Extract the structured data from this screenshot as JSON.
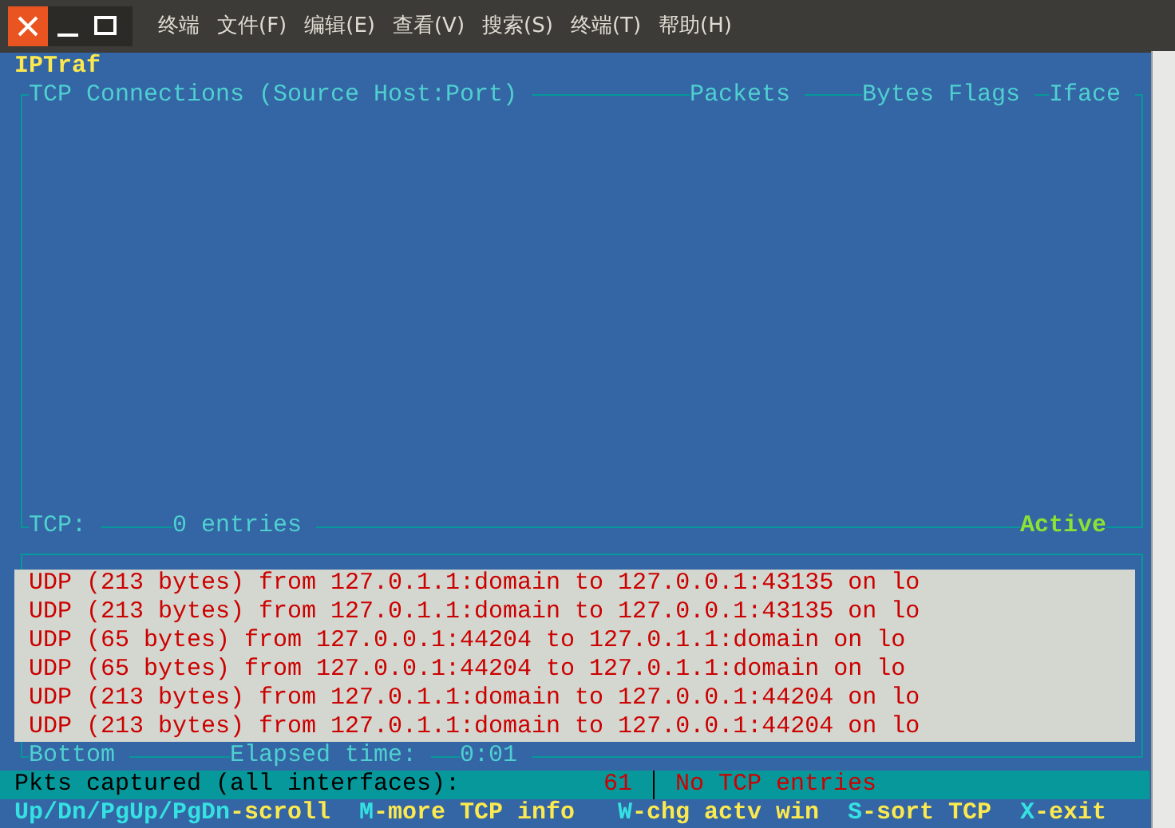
{
  "window": {
    "menu": [
      "终端",
      "文件(F)",
      "编辑(E)",
      "查看(V)",
      "搜索(S)",
      "终端(T)",
      "帮助(H)"
    ]
  },
  "app_title": "IPTraf",
  "tcp_panel": {
    "columns": [
      "TCP Connections (Source Host:Port)",
      "Packets",
      "Bytes",
      "Flags",
      "Iface"
    ],
    "footer_label": "TCP:",
    "footer_count": "0 entries",
    "status": "Active"
  },
  "log_panel": {
    "lines": [
      "UDP (213 bytes) from 127.0.1.1:domain to 127.0.0.1:43135 on lo",
      "UDP (213 bytes) from 127.0.1.1:domain to 127.0.0.1:43135 on lo",
      "UDP (65 bytes) from 127.0.0.1:44204 to 127.0.1.1:domain on lo",
      "UDP (65 bytes) from 127.0.0.1:44204 to 127.0.1.1:domain on lo",
      "UDP (213 bytes) from 127.0.1.1:domain to 127.0.0.1:44204 on lo",
      "UDP (213 bytes) from 127.0.1.1:domain to 127.0.0.1:44204 on lo"
    ],
    "footer": [
      "Bottom",
      "Elapsed time:",
      "0:01"
    ]
  },
  "status_bar": {
    "label": "Pkts captured (all interfaces):",
    "count": "61",
    "message": "No TCP entries"
  },
  "key_hints": [
    {
      "key": "Up/Dn/PgUp/PgDn",
      "action": "-scroll"
    },
    {
      "key": "M",
      "action": "-more TCP info"
    },
    {
      "key": "W",
      "action": "-chg actv win"
    },
    {
      "key": "S",
      "action": "-sort TCP"
    },
    {
      "key": "X",
      "action": "-exit"
    }
  ]
}
